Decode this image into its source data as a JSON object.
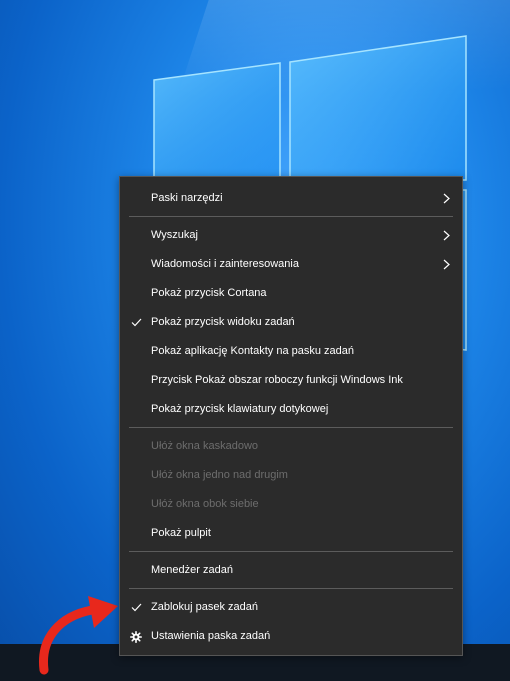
{
  "colors": {
    "menu_bg": "#2b2b2b",
    "menu_text": "#ffffff",
    "disabled_text": "#6d6d6d",
    "separator": "#5c5c5c",
    "desktop_blue": "#1c83e6",
    "taskbar": "#101822",
    "arrow_red": "#e8281c"
  },
  "icons": {
    "submenu": "chevron-right-icon",
    "checked": "checkmark-icon",
    "settings": "gear-icon"
  },
  "menu": {
    "toolbars": "Paski narzędzi",
    "search": "Wyszukaj",
    "news_interests": "Wiadomości i zainteresowania",
    "show_cortana": "Pokaż przycisk Cortana",
    "show_task_view": "Pokaż przycisk widoku zadań",
    "show_people": "Pokaż aplikację Kontakty na pasku zadań",
    "show_ink": "Przycisk Pokaż obszar roboczy funkcji Windows Ink",
    "show_keyboard": "Pokaż przycisk klawiatury dotykowej",
    "cascade": "Ułóż okna kaskadowo",
    "stacked": "Ułóż okna jedno nad drugim",
    "side_by_side": "Ułóż okna obok siebie",
    "show_desktop": "Pokaż pulpit",
    "task_manager": "Menedżer zadań",
    "lock_taskbar": "Zablokuj pasek zadań",
    "taskbar_settings": "Ustawienia paska zadań"
  }
}
